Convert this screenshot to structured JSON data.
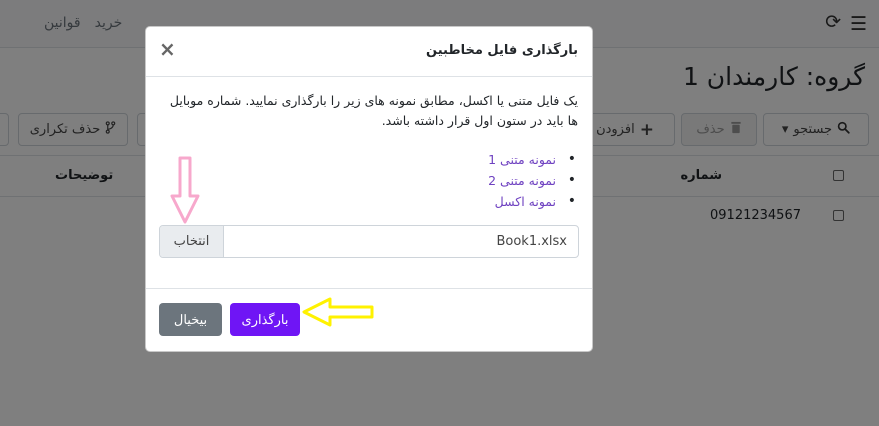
{
  "topbar": {
    "nav_items": [
      "خرید",
      "قوانین"
    ]
  },
  "page": {
    "title": "گروه: کارمندان 1"
  },
  "toolbar": {
    "search_label": "جستجو",
    "delete_label": "حذف",
    "add_label": "افزودن ش",
    "remove_duplicates_label": "حذف تکراری"
  },
  "table": {
    "columns": {
      "number": "شماره",
      "description": "توضیحات"
    },
    "rows": [
      {
        "number": "09121234567"
      }
    ]
  },
  "modal": {
    "title": "بارگذاری فایل مخاطبین",
    "instructions": "یک فایل متنی یا اکسل، مطابق نمونه های زیر را بارگذاری نمایید. شماره موبایل ها باید در ستون اول قرار داشته باشد.",
    "samples": [
      {
        "label": "نمونه متنی 1"
      },
      {
        "label": "نمونه متنی 2"
      },
      {
        "label": "نمونه اکسل"
      }
    ],
    "file_name": "Book1.xlsx",
    "browse_label": "انتخاب",
    "upload_label": "بارگذاری",
    "cancel_label": "بیخیال"
  },
  "colors": {
    "upload_button": "#6f15f5",
    "cancel_button": "#6c757d",
    "link": "#6f42c1",
    "pink_arrow": "#f7a8cc",
    "yellow_arrow": "#fff200"
  }
}
